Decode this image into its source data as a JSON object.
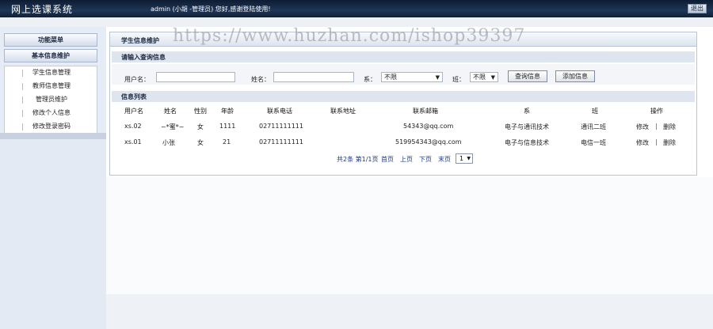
{
  "header": {
    "app_title": "网上选课系统",
    "welcome": "admin (小胡 -管理员)  您好,感谢登陆使用!",
    "logout_label": "退出"
  },
  "sidebar": {
    "menu_title": "功能菜单",
    "group_title": "基本信息维护",
    "items": [
      {
        "label": "学生信息管理"
      },
      {
        "label": "教师信息管理"
      },
      {
        "label": "管理员维护"
      },
      {
        "label": "修改个人信息"
      },
      {
        "label": "修改登录密码"
      }
    ]
  },
  "main": {
    "title": "学生信息维护",
    "search_section_title": "请输入查询信息",
    "search": {
      "username_label": "用户名：",
      "name_label": "姓名：",
      "dept_label": "系：",
      "dept_value": "不限",
      "class_label": "班：",
      "class_value": "不限",
      "query_button": "查询信息",
      "add_button": "添加信息"
    },
    "list_section_title": "信息列表",
    "table": {
      "headers": [
        "用户名",
        "姓名",
        "性别",
        "年龄",
        "联系电话",
        "联系地址",
        "联系邮箱",
        "系",
        "班",
        "操作"
      ],
      "rows": [
        {
          "username": "xs.02",
          "name": "~*蜜*~",
          "gender": "女",
          "age": "1111",
          "phone": "02711111111",
          "address": "",
          "email": "54343@qq.com",
          "dept": "电子与通讯技术",
          "class": "通讯二班",
          "edit": "修改",
          "delete": "删除"
        },
        {
          "username": "xs.01",
          "name": "小张",
          "gender": "女",
          "age": "21",
          "phone": "02711111111",
          "address": "",
          "email": "519954343@qq.com",
          "dept": "电子与信息技术",
          "class": "电信一班",
          "edit": "修改",
          "delete": "删除"
        }
      ]
    },
    "pager": {
      "summary": "共2条 第1/1页",
      "first": "首页",
      "prev": "上页",
      "next": "下页",
      "last": "末页",
      "page_value": "1"
    }
  },
  "watermark": "https://www.huzhan.com/ishop39397"
}
